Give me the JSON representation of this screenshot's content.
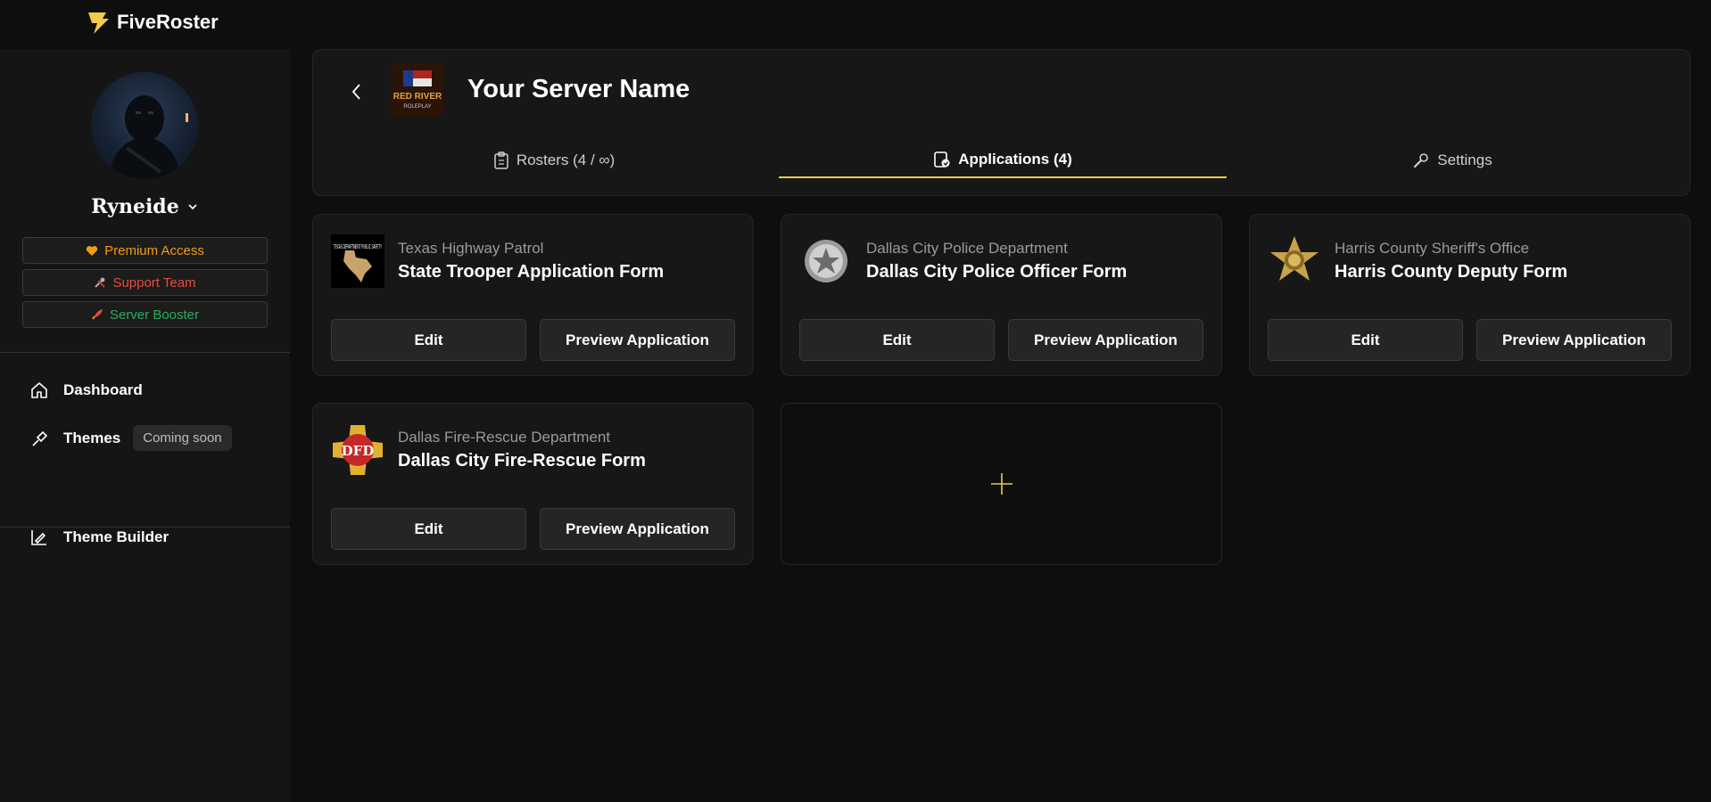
{
  "app": {
    "name": "FiveRoster"
  },
  "user": {
    "name": "Ryneide"
  },
  "badges": [
    {
      "label": "Premium Access",
      "color": "#f39c12",
      "icon": "heart-icon"
    },
    {
      "label": "Support Team",
      "color": "#e74c3c",
      "icon": "tools-icon"
    },
    {
      "label": "Server Booster",
      "color": "#27ae60",
      "icon": "rocket-icon"
    }
  ],
  "nav": {
    "dashboard": "Dashboard",
    "themes": "Themes",
    "themes_badge": "Coming soon",
    "theme_builder": "Theme Builder"
  },
  "server": {
    "name": "Your Server Name",
    "logo_text_1": "RED RIVER",
    "logo_text_2": "ROLEPLAY"
  },
  "tabs": [
    {
      "label": "Rosters (4 / ∞)",
      "icon": "clipboard-icon",
      "active": false
    },
    {
      "label": "Applications (4)",
      "icon": "application-icon",
      "active": true
    },
    {
      "label": "Settings",
      "icon": "wrench-icon",
      "active": false
    }
  ],
  "applications": [
    {
      "department": "Texas Highway Patrol",
      "title": "State Trooper Application Form",
      "logo_text": "TEXAS DEPARTMENT PUBLIC SAFETY"
    },
    {
      "department": "Dallas City Police Department",
      "title": "Dallas City Police Officer Form"
    },
    {
      "department": "Harris County Sheriff's Office",
      "title": "Harris County Deputy Form"
    },
    {
      "department": "Dallas Fire-Rescue Department",
      "title": "Dallas City Fire-Rescue Form",
      "logo_text": "DFD"
    }
  ],
  "buttons": {
    "edit": "Edit",
    "preview": "Preview Application"
  },
  "colors": {
    "accent": "#f2c94c",
    "background": "#0e0e0e",
    "panel": "#171717"
  }
}
